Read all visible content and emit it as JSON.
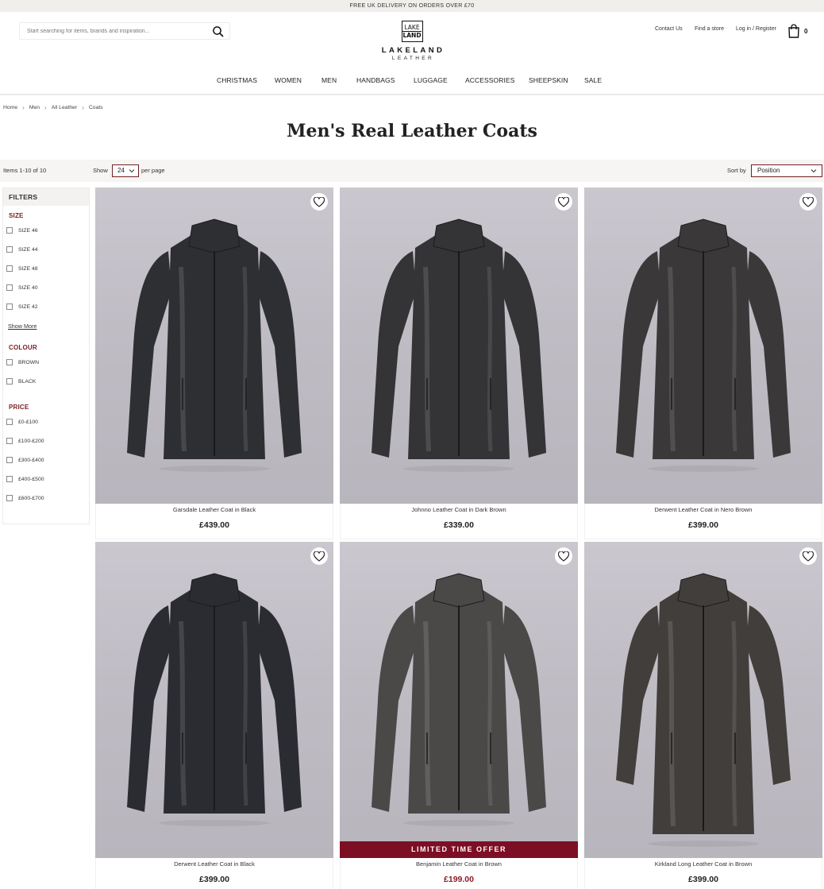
{
  "announcement": "FREE UK DELIVERY ON ORDERS OVER £70",
  "search": {
    "placeholder": "Start searching for items, brands and inspiration..."
  },
  "logo": {
    "mark_top": "LAKE",
    "mark_bottom": "LAND",
    "word": "LAKELAND",
    "sub": "LEATHER"
  },
  "header_links": {
    "contact": "Contact Us",
    "store": "Find a store",
    "account": "Log in / Register",
    "cart_count": "0"
  },
  "nav": [
    "CHRISTMAS",
    "WOMEN",
    "MEN",
    "HANDBAGS",
    "LUGGAGE",
    "ACCESSORIES",
    "SHEEPSKIN",
    "SALE"
  ],
  "breadcrumb": [
    "Home",
    "Men",
    "All Leather",
    "Coats"
  ],
  "page_title": "Men's Real Leather Coats",
  "toolbar": {
    "items_count": "Items 1-10 of 10",
    "show_label": "Show",
    "limiter_value": "24",
    "per_page": "per page",
    "sort_label": "Sort by",
    "sort_value": "Position"
  },
  "filters": {
    "title": "FILTERS",
    "size": {
      "title": "SIZE",
      "options": [
        "SIZE 46",
        "SIZE 44",
        "SIZE 48",
        "SIZE 40",
        "SIZE 42"
      ],
      "show_more": "Show More"
    },
    "colour": {
      "title": "COLOUR",
      "options": [
        "BROWN",
        "BLACK"
      ]
    },
    "price": {
      "title": "PRICE",
      "options": [
        "£0-£100",
        "£100-£200",
        "£300-£400",
        "£400-£500",
        "£600-£700"
      ]
    }
  },
  "colors": {
    "accent": "#7a1f25",
    "sale_price": "#8b1c24",
    "badge": "#7d0f24"
  },
  "products": [
    {
      "name": "Garsdale Leather Coat in Black",
      "price": "£439.00",
      "coat": "#2e2f33"
    },
    {
      "name": "Johnno Leather Coat in Dark Brown",
      "price": "£339.00",
      "coat": "#343335"
    },
    {
      "name": "Derwent Leather Coat in Nero Brown",
      "price": "£399.00",
      "coat": "#3a3839"
    },
    {
      "name": "Derwent Leather Coat in Black",
      "price": "£399.00",
      "coat": "#2b2c31"
    },
    {
      "name": "Benjamin Leather Coat in Brown",
      "price": "£199.00",
      "coat": "#4a4948",
      "badge": "LIMITED TIME OFFER",
      "sale": true
    },
    {
      "name": "Kirkland Long Leather Coat in Brown",
      "price": "£399.00",
      "coat": "#423e3c"
    }
  ]
}
